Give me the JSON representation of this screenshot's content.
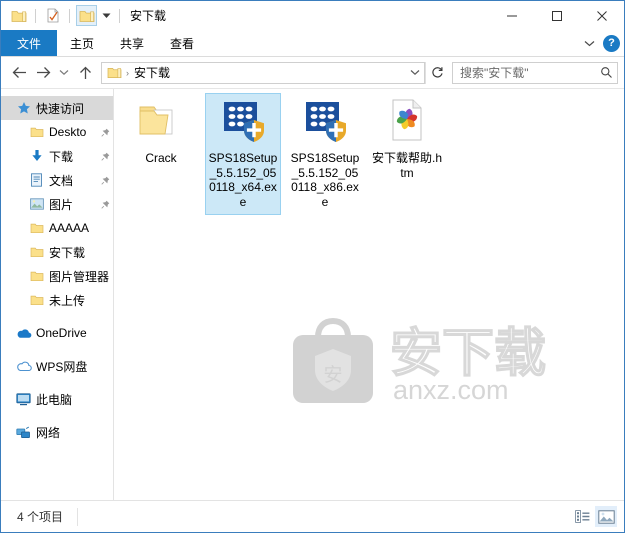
{
  "window": {
    "title": "安下载",
    "quick_access_toolbar": [
      {
        "name": "folder-icon",
        "tooltip": "属性"
      },
      {
        "name": "properties-icon",
        "tooltip": "属性"
      },
      {
        "name": "new-folder-icon",
        "tooltip": "新建文件夹"
      }
    ],
    "controls": {
      "minimize": "—",
      "maximize": "□",
      "close": "✕"
    }
  },
  "ribbon": {
    "tabs": [
      {
        "label": "文件",
        "active": true
      },
      {
        "label": "主页",
        "active": false
      },
      {
        "label": "共享",
        "active": false
      },
      {
        "label": "查看",
        "active": false
      }
    ],
    "collapse_icon": "chevron-down-icon",
    "help_label": "?"
  },
  "navigation": {
    "back": "←",
    "forward": "→",
    "recent": "⌄",
    "up": "↑",
    "address": {
      "crumb_separator": "›",
      "path": "安下载",
      "dropdown": "⌄"
    },
    "refresh": "↻",
    "search": {
      "placeholder": "搜索\"安下载\"",
      "icon": "search-icon"
    }
  },
  "sidebar": {
    "items": [
      {
        "label": "快速访问",
        "icon": "star-icon",
        "level": 0,
        "selected": true,
        "pinned": false
      },
      {
        "label": "Deskto",
        "icon": "folder-icon",
        "level": 1,
        "selected": false,
        "pinned": true
      },
      {
        "label": "下载",
        "icon": "download-icon",
        "level": 1,
        "selected": false,
        "pinned": true
      },
      {
        "label": "文档",
        "icon": "document-icon",
        "level": 1,
        "selected": false,
        "pinned": true
      },
      {
        "label": "图片",
        "icon": "pictures-icon",
        "level": 1,
        "selected": false,
        "pinned": true
      },
      {
        "label": "AAAAA",
        "icon": "folder-icon",
        "level": 1,
        "selected": false,
        "pinned": false
      },
      {
        "label": "安下载",
        "icon": "folder-icon",
        "level": 1,
        "selected": false,
        "pinned": false
      },
      {
        "label": "图片管理器",
        "icon": "folder-icon",
        "level": 1,
        "selected": false,
        "pinned": false
      },
      {
        "label": "未上传",
        "icon": "folder-icon",
        "level": 1,
        "selected": false,
        "pinned": false
      },
      {
        "label": "OneDrive",
        "icon": "onedrive-cloud-icon",
        "level": 0,
        "selected": false,
        "pinned": false,
        "gap_before": true
      },
      {
        "label": "WPS网盘",
        "icon": "wps-cloud-icon",
        "level": 0,
        "selected": false,
        "pinned": false,
        "gap_before": true
      },
      {
        "label": "此电脑",
        "icon": "this-pc-icon",
        "level": 0,
        "selected": false,
        "pinned": false,
        "gap_before": true
      },
      {
        "label": "网络",
        "icon": "network-icon",
        "level": 0,
        "selected": false,
        "pinned": false,
        "gap_before": true
      }
    ]
  },
  "files": {
    "items": [
      {
        "name": "Crack",
        "icon": "folder-with-file-icon",
        "selected": false
      },
      {
        "name": "SPS18Setup_5.5.152_050118_x64.exe",
        "icon": "spss-setup-shield-icon",
        "selected": true
      },
      {
        "name": "SPS18Setup_5.5.152_050118_x86.exe",
        "icon": "spss-setup-shield-icon",
        "selected": false
      },
      {
        "name": "安下载帮助.htm",
        "icon": "html-pinwheel-icon",
        "selected": false
      }
    ]
  },
  "watermark": {
    "logo_char": "安",
    "brand": "安下载",
    "site": "anxz.com"
  },
  "statusbar": {
    "item_count": "4 个项目",
    "views": [
      {
        "name": "details-view-icon",
        "active": false
      },
      {
        "name": "large-icons-view-icon",
        "active": true
      }
    ]
  },
  "colors": {
    "accent": "#1a7ac4",
    "selection_fill": "#cce8f7",
    "selection_border": "#99d1f0",
    "folder_yellow": "#fce79a",
    "spss_blue": "#1b4f9c"
  }
}
